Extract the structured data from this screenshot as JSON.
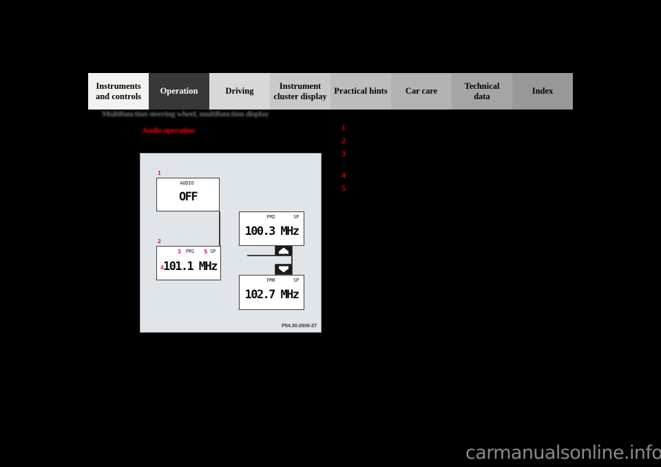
{
  "page": {
    "background_color": "#000000",
    "watermark": "carmanualsonline.info"
  },
  "tabs": [
    {
      "label": "Instruments\nand controls",
      "bg": "#f2f2f0",
      "text": "#000000",
      "width": 88,
      "active": false
    },
    {
      "label": "Operation",
      "bg": "#383838",
      "text": "#ffffff",
      "width": 88,
      "active": true
    },
    {
      "label": "Driving",
      "bg": "#d8d8d8",
      "text": "#000000",
      "width": 88,
      "active": false
    },
    {
      "label": "Instrument\ncluster display",
      "bg": "#c9c9c9",
      "text": "#000000",
      "width": 88,
      "active": false
    },
    {
      "label": "Practical hints",
      "bg": "#bdbdbd",
      "text": "#000000",
      "width": 88,
      "active": false
    },
    {
      "label": "Car care",
      "bg": "#b2b2b2",
      "text": "#000000",
      "width": 88,
      "active": false
    },
    {
      "label": "Technical\ndata",
      "bg": "#a5a5a5",
      "text": "#000000",
      "width": 88,
      "active": false
    },
    {
      "label": "Index",
      "bg": "#989898",
      "text": "#000000",
      "width": 88,
      "active": false
    }
  ],
  "headings": {
    "section": "Multifunction steering wheel, multifunction display",
    "subsection": "Audio operation"
  },
  "legend": {
    "items": [
      {
        "number": "1",
        "text": ""
      },
      {
        "number": "2",
        "text": ""
      },
      {
        "number": "3",
        "text": ""
      },
      {
        "number": "4",
        "text": ""
      },
      {
        "number": "5",
        "text": ""
      }
    ]
  },
  "figure": {
    "code": "P54.30-2936-27",
    "panel_bg": "#e0e5ea",
    "callout_color": "#e6007e",
    "displays": [
      {
        "id": "audio-off",
        "callout": "1",
        "band": "AUDIO",
        "sp": "",
        "main": "OFF"
      },
      {
        "id": "fm1",
        "callout": "2",
        "band": "FM1",
        "band_callout": "3",
        "sp": "SP",
        "sp_callout": "5",
        "main": "101.1 MHz",
        "main_callout": "4",
        "frequency": "101.1",
        "unit": "MHz"
      },
      {
        "id": "fm2",
        "band": "FM2",
        "sp": "SP",
        "main": "100.3 MHz",
        "frequency": "100.3",
        "unit": "MHz"
      },
      {
        "id": "fm0",
        "band": "FM0",
        "sp": "SP",
        "main": "102.7 MHz",
        "frequency": "102.7",
        "unit": "MHz"
      }
    ],
    "buttons": [
      {
        "id": "scroll-up",
        "icon": "arrow-up-pentagon"
      },
      {
        "id": "scroll-down",
        "icon": "arrow-down-pentagon"
      }
    ]
  }
}
